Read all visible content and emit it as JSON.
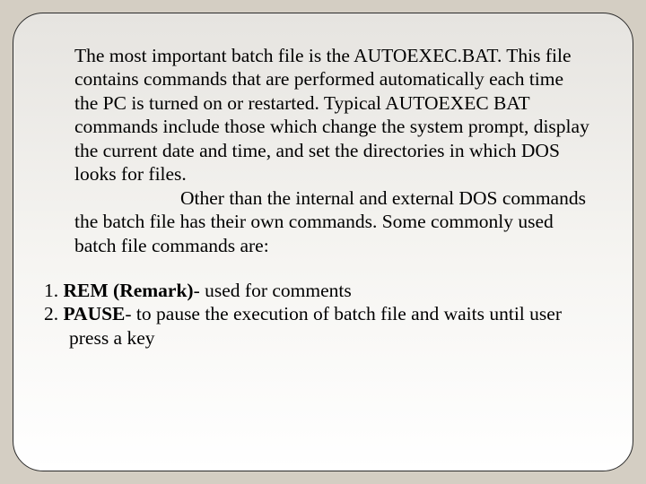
{
  "body": {
    "paragraph": "The most important batch file is the AUTOEXEC.BAT. This file contains commands that are performed automatically each time the PC is turned on or restarted. Typical AUTOEXEC BAT commands include those which change the system prompt, display the current date and time, and set the directories in which DOS looks for files.",
    "paragraph2": "Other than the internal and external DOS commands the batch file has their own commands. Some commonly used batch file commands are:"
  },
  "list": {
    "item1_num": "1. ",
    "item1_bold": "REM (Remark)",
    "item1_rest": "-    used for comments",
    "item2_num": "2. ",
    "item2_bold": "PAUSE",
    "item2_rest": "- to pause the execution of batch file and waits until user press a key"
  }
}
